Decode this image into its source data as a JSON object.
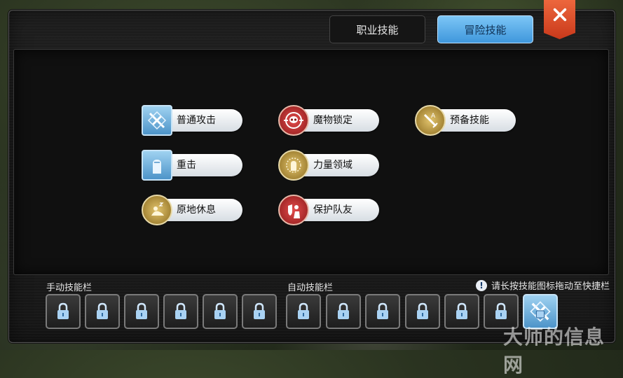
{
  "tabs": {
    "job": "职业技能",
    "adventure": "冒险技能"
  },
  "skills": [
    {
      "label": "普通攻击",
      "icon": "sword-slash-icon"
    },
    {
      "label": "魔物锁定",
      "icon": "skull-target-icon"
    },
    {
      "label": "预备技能",
      "icon": "sword-ready-icon"
    },
    {
      "label": "重击",
      "icon": "fist-icon"
    },
    {
      "label": "力量领域",
      "icon": "fist-aura-icon"
    },
    {
      "label": "原地休息",
      "icon": "rest-icon"
    },
    {
      "label": "保护队友",
      "icon": "protect-icon"
    }
  ],
  "bars": {
    "manual": "手动技能栏",
    "auto": "自动技能栏"
  },
  "hint": "请长按技能图标拖动至快捷栏",
  "watermark": "大师的信息网",
  "colors": {
    "accent_tab": "#3f97dc",
    "close": "#d9481f",
    "pill": "#ffffff"
  }
}
